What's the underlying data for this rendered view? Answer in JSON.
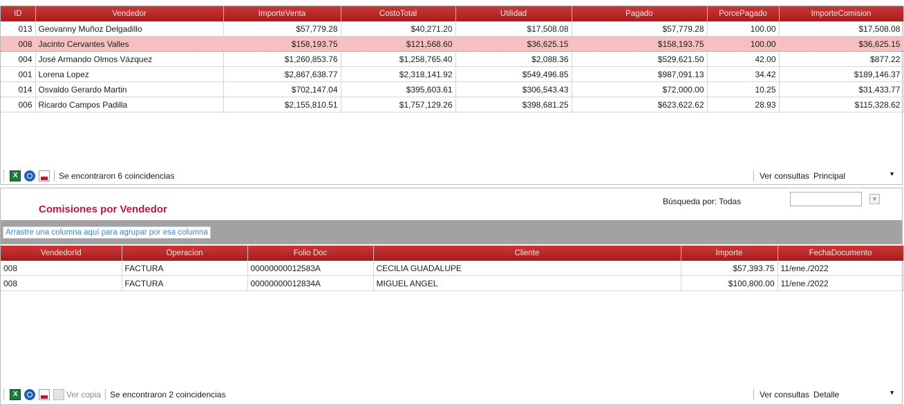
{
  "top_grid": {
    "columns": [
      "ID",
      "Vendedor",
      "ImporteVenta",
      "CostoTotal",
      "Utilidad",
      "Pagado",
      "PorcePagado",
      "ImporteComision"
    ],
    "rows": [
      [
        "013",
        "Geovanny Muñoz Delgadillo",
        "$57,779.28",
        "$40,271.20",
        "$17,508.08",
        "$57,779.28",
        "100.00",
        "$17,508.08"
      ],
      [
        "008",
        "Jacinto Cervantes Valles",
        "$158,193.75",
        "$121,568.60",
        "$36,625.15",
        "$158,193.75",
        "100.00",
        "$36,625.15"
      ],
      [
        "004",
        "José Armando Olmos Vázquez",
        "$1,260,853.76",
        "$1,258,765.40",
        "$2,088.36",
        "$529,621.50",
        "42.00",
        "$877.22"
      ],
      [
        "001",
        "Lorena Lopez",
        "$2,867,638.77",
        "$2,318,141.92",
        "$549,496.85",
        "$987,091.13",
        "34.42",
        "$189,146.37"
      ],
      [
        "014",
        "Osvaldo Gerardo Martin",
        "$702,147.04",
        "$395,603.61",
        "$306,543.43",
        "$72,000.00",
        "10.25",
        "$31,433.77"
      ],
      [
        "006",
        "Ricardo Campos Padilla",
        "$2,155,810.51",
        "$1,757,129.26",
        "$398,681.25",
        "$623,622.62",
        "28.93",
        "$115,328.62"
      ]
    ],
    "selected_row": 1,
    "status": "Se encontraron 6 coincidencias",
    "ver_consultas_label": "Ver consultas",
    "ver_consultas_value": "Principal"
  },
  "bottom": {
    "title": "Comisiones por Vendedor",
    "search_label": "Búsqueda por: Todas",
    "search_value": "",
    "group_hint": "Arrastre una columna aquí para agrupar por esa columna",
    "columns": [
      "VendedorId",
      "Operacion",
      "Folio Doc",
      "Cliente",
      "Importe",
      "FechaDocumento"
    ],
    "rows": [
      [
        "008",
        "FACTURA",
        "00000000012583A",
        "CECILIA GUADALUPE",
        "$57,393.75",
        "11/ene./2022"
      ],
      [
        "008",
        "FACTURA",
        "00000000012834A",
        "MIGUEL ANGEL",
        "$100,800.00",
        "11/ene./2022"
      ]
    ],
    "ver_copia_label": "Ver copia",
    "status": "Se encontraron 2 coincidencias",
    "ver_consultas_label": "Ver consultas",
    "ver_consultas_value": "Detalle"
  },
  "icons": [
    "excel-icon",
    "web-export-icon",
    "pdf-icon",
    "copy-icon",
    "chevron-down-icon"
  ],
  "colors": {
    "header_red": "#b32424",
    "selected_row": "#f7c0c0",
    "title_red": "#c0143c",
    "group_bar": "#a2a2a2",
    "link_blue": "#3a86d4"
  }
}
